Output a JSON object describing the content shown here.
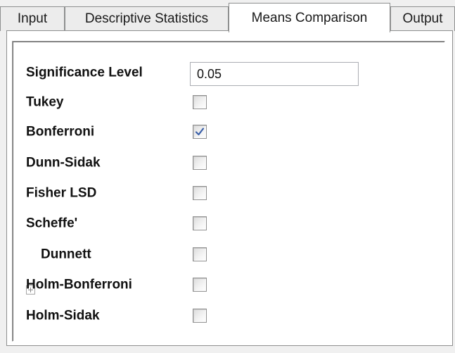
{
  "tabs": [
    {
      "label": "Input",
      "active": false
    },
    {
      "label": "Descriptive Statistics",
      "active": false
    },
    {
      "label": "Means Comparison",
      "active": true
    },
    {
      "label": "Output",
      "active": false
    }
  ],
  "significance": {
    "label": "Significance Level",
    "value": "0.05"
  },
  "options": [
    {
      "label": "Tukey",
      "checked": false
    },
    {
      "label": "Bonferroni",
      "checked": true
    },
    {
      "label": "Dunn-Sidak",
      "checked": false
    },
    {
      "label": "Fisher LSD",
      "checked": false
    },
    {
      "label": "Scheffe'",
      "checked": false
    },
    {
      "label": "Dunnett",
      "checked": false,
      "expandable": true,
      "expander_icon": "plus-expander-icon"
    },
    {
      "label": "Holm-Bonferroni",
      "checked": false
    },
    {
      "label": "Holm-Sidak",
      "checked": false
    }
  ],
  "colors": {
    "check_mark": "#3a5fa8"
  }
}
